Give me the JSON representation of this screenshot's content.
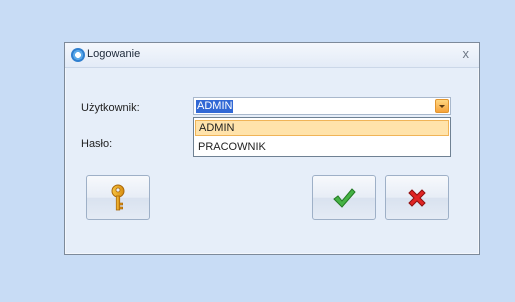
{
  "dialog": {
    "title": "Logowanie",
    "close_glyph": "x",
    "icon": "app-logo-icon"
  },
  "form": {
    "user_label": "Użytkownik:",
    "password_label": "Hasło:",
    "user_selected": "ADMIN",
    "user_options": [
      "ADMIN",
      "PRACOWNIK"
    ]
  },
  "buttons": {
    "key_icon": "key-icon",
    "ok_icon": "checkmark-icon",
    "cancel_icon": "cross-icon"
  },
  "colors": {
    "accent": "#f6a33b",
    "selection": "#3168d5",
    "ok": "#3aa13a",
    "cancel": "#d21d1d"
  }
}
